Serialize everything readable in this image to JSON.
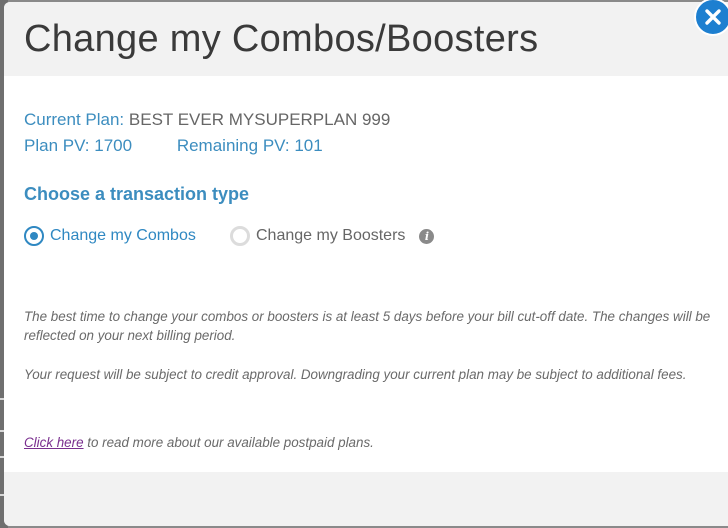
{
  "modal": {
    "title": "Change my Combos/Boosters",
    "close_glyph": "✕"
  },
  "plan": {
    "current_plan_label": "Current Plan:",
    "current_plan_value": "BEST EVER MYSUPERPLAN 999",
    "plan_pv_label": "Plan PV:",
    "plan_pv_value": "1700",
    "remaining_pv_label": "Remaining PV:",
    "remaining_pv_value": "101"
  },
  "transaction": {
    "heading": "Choose a transaction type",
    "options": [
      {
        "label": "Change my Combos",
        "selected": true
      },
      {
        "label": "Change my Boosters",
        "selected": false
      }
    ],
    "info_glyph": "i"
  },
  "notes": {
    "timing": "The best time to change your combos or boosters is at least 5 days before your bill cut-off date. The changes will be reflected on your next billing period.",
    "approval": "Your request will be subject to credit approval. Downgrading your current plan may be subject to additional fees.",
    "link_text": "Click here",
    "link_suffix": " to read more about our available postpaid plans."
  },
  "colors": {
    "accent_blue": "#3c8dbf",
    "close_button": "#1d7fd0",
    "link_purple": "#7a2f8f"
  },
  "icons": [
    "close-icon",
    "radio-checked-icon",
    "radio-unchecked-icon",
    "info-icon"
  ]
}
